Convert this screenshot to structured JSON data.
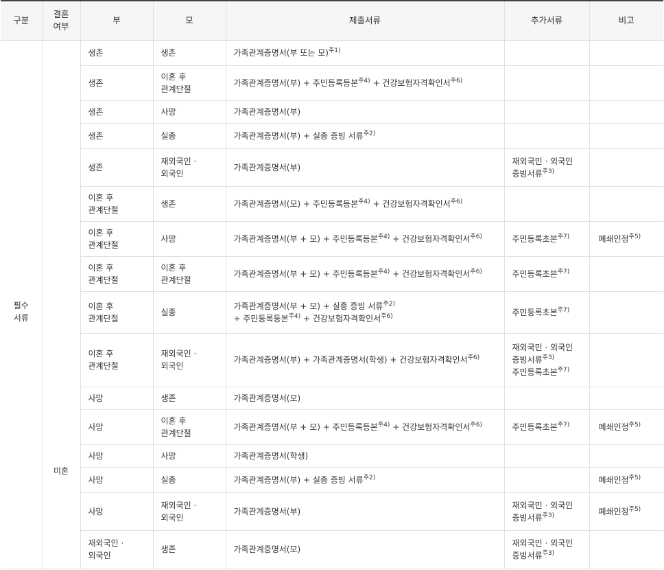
{
  "headers": [
    "구분",
    "결혼\n여부",
    "부",
    "모",
    "제출서류",
    "추가서류",
    "비고"
  ],
  "category": "필수\n서류",
  "marital": "미혼",
  "rows": [
    {
      "father": "생존",
      "mother": "생존",
      "docs": [
        [
          "가족관계증명서(부 또는 모)",
          "주1)"
        ]
      ],
      "extra": [],
      "note": []
    },
    {
      "father": "생존",
      "mother": "이혼 후\n관계단절",
      "docs": [
        [
          "가족관계증명서(부) + 주민등록등본",
          "주4)"
        ],
        [
          " + 건강보험자격확인서",
          "주6)"
        ]
      ],
      "extra": [],
      "note": []
    },
    {
      "father": "생존",
      "mother": "사망",
      "docs": [
        [
          "가족관계증명서(부)",
          ""
        ]
      ],
      "extra": [],
      "note": []
    },
    {
      "father": "생존",
      "mother": "실종",
      "docs": [
        [
          "가족관계증명서(부) + 실종 증빙 서류",
          "주2)"
        ]
      ],
      "extra": [],
      "note": []
    },
    {
      "father": "생존",
      "mother": "재외국인 ·\n외국인",
      "docs": [
        [
          "가족관계증명서(부)",
          ""
        ]
      ],
      "extra": [
        [
          "재외국민 · 외국인\n증빙서류",
          "주3)"
        ]
      ],
      "note": []
    },
    {
      "father": "이혼 후\n관계단절",
      "mother": "생존",
      "docs": [
        [
          "가족관계증명서(모) + 주민등록등본",
          "주4)"
        ],
        [
          " + 건강보험자격확인서",
          "주6)"
        ]
      ],
      "extra": [],
      "note": []
    },
    {
      "father": "이혼 후\n관계단절",
      "mother": "사망",
      "docs": [
        [
          "가족관계증명서(부 + 모) + 주민등록등본",
          "주4)"
        ],
        [
          " + 건강보험자격확인서",
          "주6)"
        ]
      ],
      "extra": [
        [
          "주민등록초본",
          "주7)"
        ]
      ],
      "note": [
        [
          "폐쇄인정",
          "주5)"
        ]
      ]
    },
    {
      "father": "이혼 후\n관계단절",
      "mother": "이혼 후\n관계단절",
      "docs": [
        [
          "가족관계증명서(부 + 모) + 주민등록등본",
          "주4)"
        ],
        [
          " + 건강보험자격확인서",
          "주6)"
        ]
      ],
      "extra": [
        [
          "주민등록초본",
          "주7)"
        ]
      ],
      "note": []
    },
    {
      "father": "이혼 후\n관계단절",
      "mother": "실종",
      "docs": [
        [
          "가족관계증명서(부 + 모) + 실종 증빙 서류",
          "주2)"
        ],
        [
          "\n+ 주민등록등본",
          "주4)"
        ],
        [
          " + 건강보험자격확인서",
          "주6)"
        ]
      ],
      "extra": [
        [
          "주민등록초본",
          "주7)"
        ]
      ],
      "note": []
    },
    {
      "father": "이혼 후\n관계단절",
      "mother": "재외국인 ·\n외국인",
      "docs": [
        [
          "가족관계증명서(부) + 가족관계증명서(학생) + 건강보험자격확인서",
          "주6)"
        ]
      ],
      "extra": [
        [
          "재외국민 · 외국인\n증빙서류",
          "주3)"
        ],
        [
          "\n주민등록초본",
          "주7)"
        ]
      ],
      "note": []
    },
    {
      "father": "사망",
      "mother": "생존",
      "docs": [
        [
          "가족관계증명서(모)",
          ""
        ]
      ],
      "extra": [],
      "note": []
    },
    {
      "father": "사망",
      "mother": "이혼 후\n관계단절",
      "docs": [
        [
          "가족관계증명서(부 + 모) + 주민등록등본",
          "주4)"
        ],
        [
          " + 건강보험자격확인서",
          "주6)"
        ]
      ],
      "extra": [
        [
          "주민등록초본",
          "주7)"
        ]
      ],
      "note": [
        [
          "폐쇄인정",
          "주5)"
        ]
      ]
    },
    {
      "father": "사망",
      "mother": "사망",
      "docs": [
        [
          "가족관계증명서(학생)",
          ""
        ]
      ],
      "extra": [],
      "note": []
    },
    {
      "father": "사망",
      "mother": "실종",
      "docs": [
        [
          "가족관계증명서(부) + 실종 증빙 서류",
          "주2)"
        ]
      ],
      "extra": [],
      "note": [
        [
          "폐쇄인정",
          "주5)"
        ]
      ]
    },
    {
      "father": "사망",
      "mother": "재외국인 ·\n외국인",
      "docs": [
        [
          "가족관계증명서(부)",
          ""
        ]
      ],
      "extra": [
        [
          "재외국민 · 외국인\n증빙서류",
          "주3)"
        ]
      ],
      "note": [
        [
          "폐쇄인정",
          "주5)"
        ]
      ]
    },
    {
      "father": "재외국인 ·\n외국인",
      "mother": "생존",
      "docs": [
        [
          "가족관계증명서(모)",
          ""
        ]
      ],
      "extra": [
        [
          "재외국민 · 외국인\n증빙서류",
          "주3)"
        ]
      ],
      "note": []
    }
  ]
}
